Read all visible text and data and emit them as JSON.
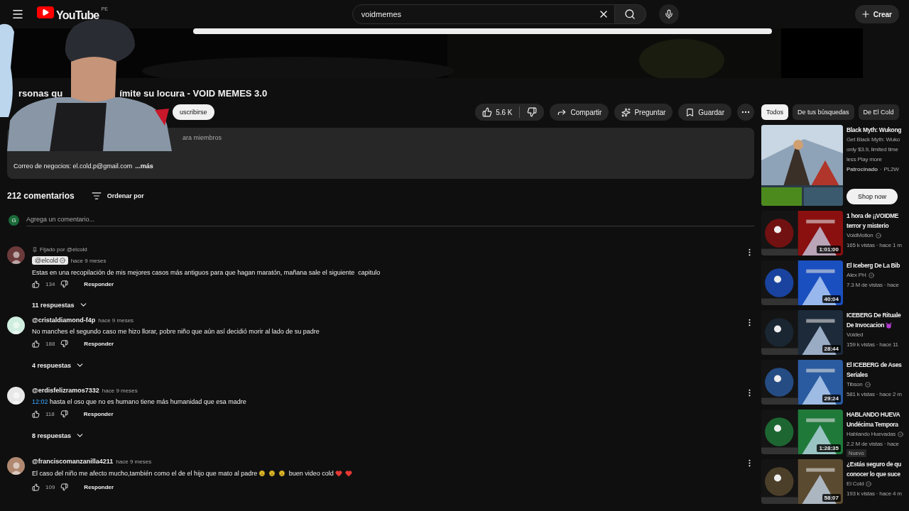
{
  "topbar": {
    "logo": "YouTube",
    "country": "PE",
    "search": {
      "value": "voidmemes"
    },
    "create": "Crear"
  },
  "video": {
    "kind": "picture"
  },
  "webcam": {
    "kind": "picture"
  },
  "title_parts": [
    "rsonas qu",
    "ímite su locura - VOID MEMES 3.0"
  ],
  "subscribe": "uscribirse",
  "actions": {
    "likes": "5.6 K",
    "share": "Compartir",
    "ask": "Preguntar",
    "save": "Guardar"
  },
  "description": {
    "line_1": "ara miembros",
    "line_2": "Correo de negocios: el.cold.p@gmail.com",
    "more": "...más"
  },
  "comments_header": {
    "count": "212 comentarios",
    "sort": "Ordenar por"
  },
  "add_comment": {
    "avatar_letter": "G",
    "placeholder": "Agrega un comentario..."
  },
  "comments": [
    {
      "pinned": "Fijado por @elcold",
      "author": "@elcold",
      "author_badge": true,
      "verified": true,
      "time": "hace 9 meses",
      "color": "#6b3a3a",
      "text": [
        {
          "kind": "text",
          "text": "Estas en una recopilación de mis mejores casos más antiguos para que hagan maratón, mañana sale el siguiente  capitulo"
        }
      ],
      "likes": "134",
      "reply": "Responder",
      "replies": "11 respuestas"
    },
    {
      "author": "@cristaldiamond-f4p",
      "author_badge": false,
      "verified": false,
      "time": "hace 9 meses",
      "color": "#cfeee0",
      "text": [
        {
          "kind": "text",
          "text": "No manches el segundo caso me hizo llorar, pobre niño que aún así decidió morir al lado de su padre"
        }
      ],
      "likes": "188",
      "reply": "Responder",
      "replies": "4 respuestas"
    },
    {
      "author": "@erdisfelizramos7332",
      "author_badge": false,
      "verified": false,
      "time": "hace 9 meses",
      "color": "#e8e8e8",
      "text": [
        {
          "kind": "timestamp",
          "text": "12:02"
        },
        {
          "kind": "text",
          "text": " hasta el oso que no es humano tiene más humanidad que esa madre"
        }
      ],
      "likes": "118",
      "reply": "Responder",
      "replies": "8 respuestas"
    },
    {
      "author": "@franciscomanzanilla4211",
      "author_badge": false,
      "verified": false,
      "time": "hace 9 meses",
      "color": "#b08870",
      "text": [
        {
          "kind": "text",
          "text": "El caso del niño me afecto mucho,también como el de el hijo que mato al padre"
        },
        {
          "kind": "worried"
        },
        {
          "kind": "worried"
        },
        {
          "kind": "worried"
        },
        {
          "kind": "text",
          "text": " buen video cold"
        },
        {
          "kind": "heart"
        },
        {
          "kind": "heart"
        }
      ],
      "likes": "109",
      "reply": "Responder"
    }
  ],
  "chips": [
    {
      "label": "Todos",
      "selected": true
    },
    {
      "label": "De tus búsquedas",
      "selected": false
    },
    {
      "label": "De El Cold",
      "selected": false
    }
  ],
  "ad": {
    "title": "Black Myth: Wukong",
    "lines": [
      "Get Black Myth: Wuko",
      "only $3.9, limited time",
      "less Play more"
    ],
    "sponsor": "Patrocinado",
    "separator": "·",
    "advertiser": "PL2W",
    "button": "Shop now"
  },
  "videos": [
    {
      "title_lines": [
        "1 hora de ¡¡VOIDME",
        "terror y misterio"
      ],
      "channel": "VoidMotion",
      "verified": true,
      "stats": "165 k vistas · hace 1 m",
      "duration": "1:01:00",
      "color": "#8a1010"
    },
    {
      "title_lines": [
        "El Iceberg De La Bib"
      ],
      "channel": "Alex PH",
      "verified": true,
      "stats": "7.3 M de vistas · hace",
      "duration": "40:04",
      "color": "#1a4fc0"
    },
    {
      "title_lines": [
        "ICEBERG De Rituale",
        "De Invocacion"
      ],
      "title_icons": [
        {
          "kind": "devil"
        }
      ],
      "channel": "Voided",
      "verified": false,
      "stats": "159 k vistas · hace 11",
      "duration": "28:44",
      "color": "#1c2a3a"
    },
    {
      "title_lines": [
        "El ICEBERG de Ases",
        "Seriales"
      ],
      "channel": "Tibson",
      "verified": true,
      "stats": "581 k vistas · hace 2 m",
      "duration": "29:24",
      "color": "#2a5aa0"
    },
    {
      "title_lines": [
        "HABLANDO HUEVA",
        "Undécima Tempora"
      ],
      "channel": "Hablando Huevadas",
      "verified": true,
      "stats": "2.2 M de vistas · hace",
      "badge": "Nuevo",
      "duration": "1:28:35",
      "color": "#1f7a3a"
    },
    {
      "title_lines": [
        "¿Estás seguro de qu",
        "conocer lo que suce"
      ],
      "channel": "El Cold",
      "verified": true,
      "stats": "193 k vistas · hace 4 m",
      "duration": "58:07",
      "color": "#5a4a30"
    }
  ]
}
